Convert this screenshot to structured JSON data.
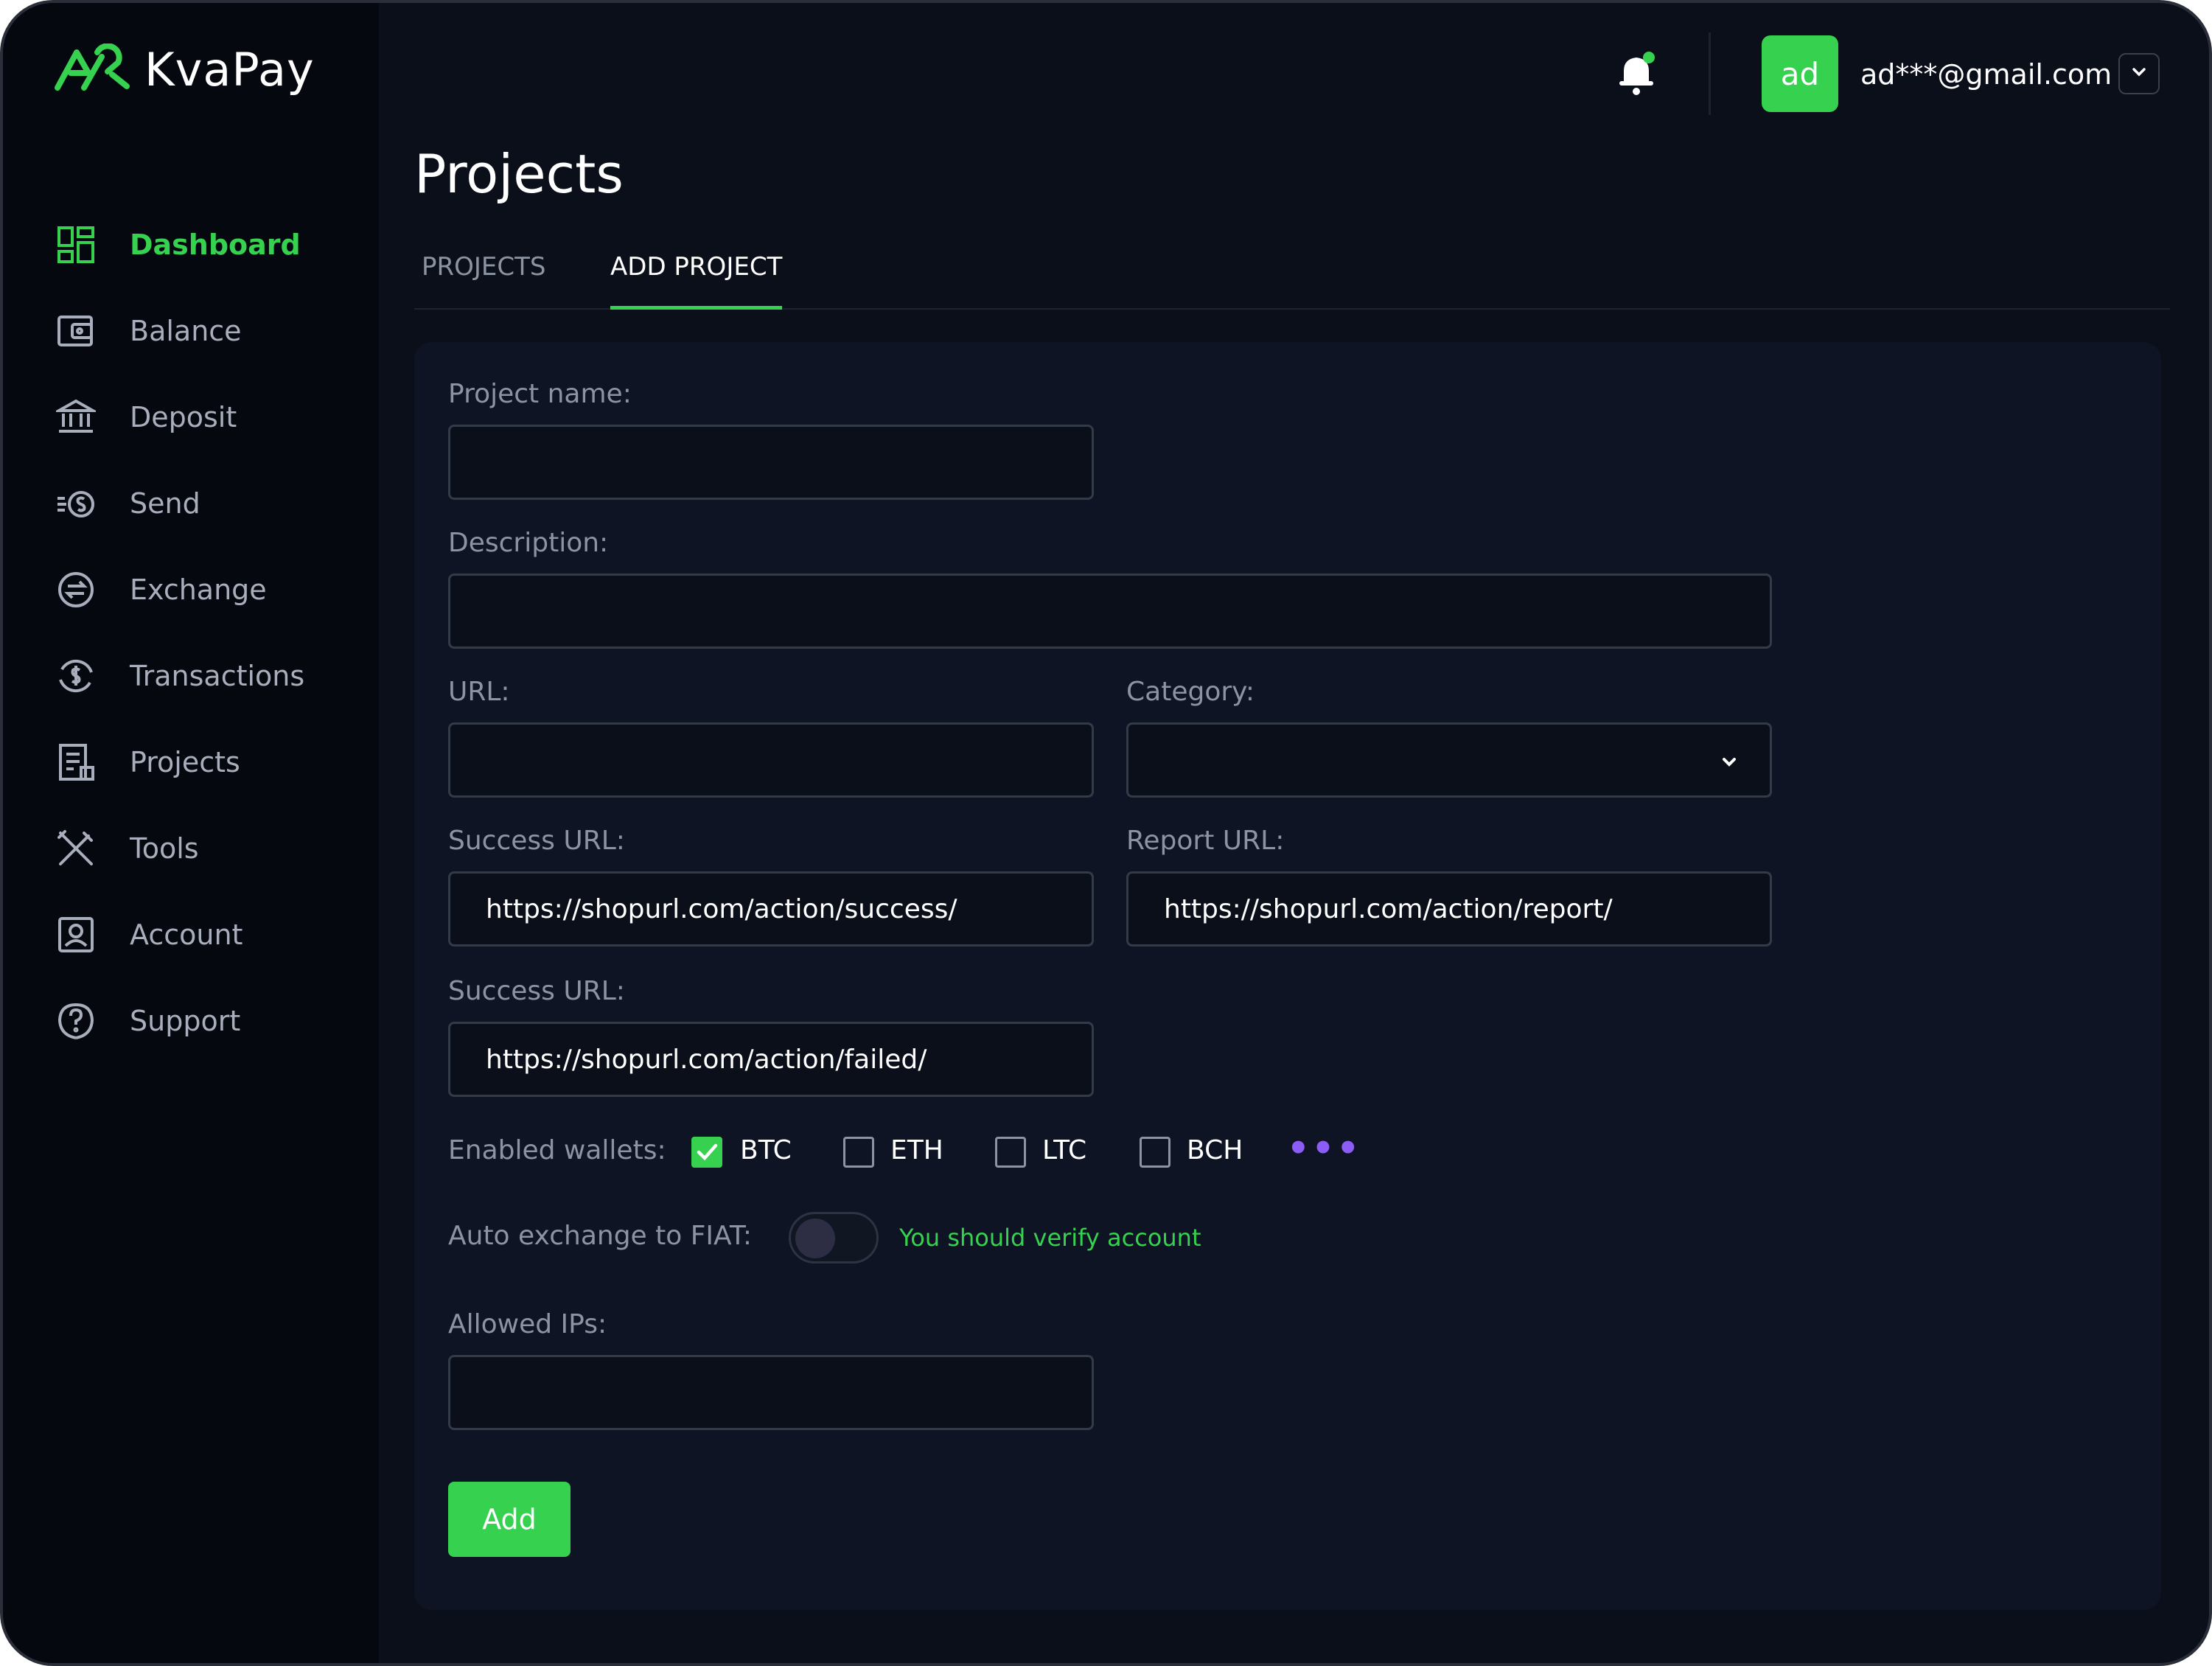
{
  "app": {
    "logo_text": "KvaPay"
  },
  "header": {
    "avatar_initials": "ad",
    "user_email": "ad***@gmail.com"
  },
  "sidebar": {
    "items": [
      {
        "label": "Dashboard",
        "icon": "dashboard-icon",
        "active": true
      },
      {
        "label": "Balance",
        "icon": "wallet-icon",
        "active": false
      },
      {
        "label": "Deposit",
        "icon": "bank-icon",
        "active": false
      },
      {
        "label": "Send",
        "icon": "send-money-icon",
        "active": false
      },
      {
        "label": "Exchange",
        "icon": "exchange-icon",
        "active": false
      },
      {
        "label": "Transactions",
        "icon": "transactions-icon",
        "active": false
      },
      {
        "label": "Projects",
        "icon": "projects-icon",
        "active": false
      },
      {
        "label": "Tools",
        "icon": "tools-icon",
        "active": false
      },
      {
        "label": "Account",
        "icon": "account-icon",
        "active": false
      },
      {
        "label": "Support",
        "icon": "support-icon",
        "active": false
      }
    ]
  },
  "page": {
    "title": "Projects",
    "tabs": [
      {
        "label": "PROJECTS",
        "active": false
      },
      {
        "label": "ADD PROJECT",
        "active": true
      }
    ]
  },
  "form": {
    "project_name": {
      "label": "Project name:",
      "value": ""
    },
    "description": {
      "label": "Description:",
      "value": ""
    },
    "url": {
      "label": "URL:",
      "value": ""
    },
    "category": {
      "label": "Category:",
      "value": ""
    },
    "success_url": {
      "label": "Success URL:",
      "value": "https://shopurl.com/action/success/"
    },
    "report_url": {
      "label": "Report URL:",
      "value": "https://shopurl.com/action/report/"
    },
    "failed_url": {
      "label": "Success URL:",
      "value": "https://shopurl.com/action/failed/"
    },
    "wallets": {
      "label": "Enabled wallets:",
      "options": [
        {
          "label": "BTC",
          "checked": true
        },
        {
          "label": "ETH",
          "checked": false
        },
        {
          "label": "LTC",
          "checked": false
        },
        {
          "label": "BCH",
          "checked": false
        }
      ],
      "more": "•••"
    },
    "auto_exchange": {
      "label": "Auto exchange to FIAT:",
      "enabled": false,
      "message": "You should verify account"
    },
    "allowed_ips": {
      "label": "Allowed IPs:",
      "value": ""
    },
    "submit_label": "Add"
  },
  "colors": {
    "accent": "#35d14f",
    "background": "#0b0f1a",
    "sidebar": "#06080f",
    "card": "#0f1424",
    "more_dots": "#8b5cf6"
  }
}
